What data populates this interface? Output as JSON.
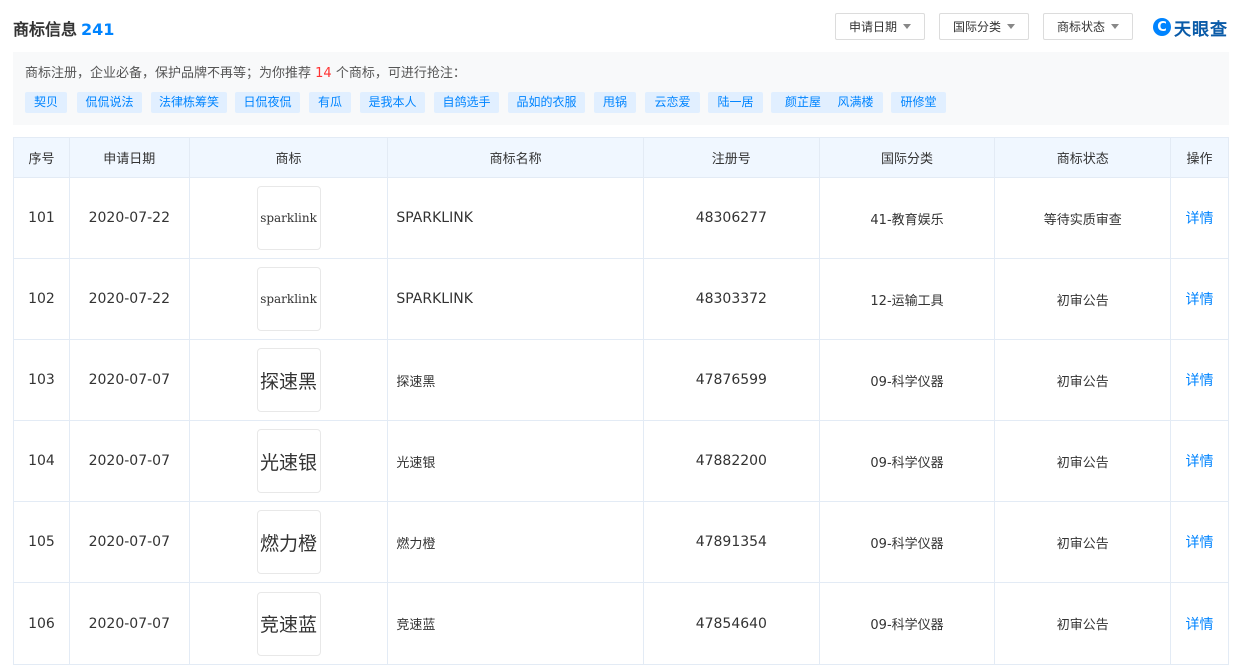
{
  "header": {
    "title": "商标信息",
    "count": "241",
    "filters": [
      "申请日期",
      "国际分类",
      "商标状态"
    ],
    "logo_text": "天眼查"
  },
  "recommend": {
    "text_before": "商标注册，企业必备，保护品牌不再等；为你推荐 ",
    "number": "14",
    "text_after": " 个商标，可进行抢注：",
    "tags": [
      "契贝",
      "侃侃说法",
      "法律栋筹笑",
      "日侃夜侃",
      "有瓜",
      "是我本人",
      "自鸽选手",
      "品如的衣服",
      "甩锅",
      "云恋爱",
      "陆一居",
      "颜芷屋",
      "风满楼",
      "研修堂"
    ]
  },
  "table": {
    "columns": [
      "序号",
      "申请日期",
      "商标",
      "商标名称",
      "注册号",
      "国际分类",
      "商标状态",
      "操作"
    ],
    "rows": [
      {
        "no": "101",
        "date": "2020-07-22",
        "mark": "sparklink",
        "name": "SPARKLINK",
        "reg": "48306277",
        "class": "41-教育娱乐",
        "status": "等待实质审查",
        "action": "详情"
      },
      {
        "no": "102",
        "date": "2020-07-22",
        "mark": "sparklink",
        "name": "SPARKLINK",
        "reg": "48303372",
        "class": "12-运输工具",
        "status": "初审公告",
        "action": "详情"
      },
      {
        "no": "103",
        "date": "2020-07-07",
        "mark": "探速黑",
        "name": "探速黑",
        "reg": "47876599",
        "class": "09-科学仪器",
        "status": "初审公告",
        "action": "详情"
      },
      {
        "no": "104",
        "date": "2020-07-07",
        "mark": "光速银",
        "name": "光速银",
        "reg": "47882200",
        "class": "09-科学仪器",
        "status": "初审公告",
        "action": "详情"
      },
      {
        "no": "105",
        "date": "2020-07-07",
        "mark": "燃力橙",
        "name": "燃力橙",
        "reg": "47891354",
        "class": "09-科学仪器",
        "status": "初审公告",
        "action": "详情"
      },
      {
        "no": "106",
        "date": "2020-07-07",
        "mark": "竞速蓝",
        "name": "竞速蓝",
        "reg": "47854640",
        "class": "09-科学仪器",
        "status": "初审公告",
        "action": "详情"
      }
    ]
  },
  "colors": {
    "accent": "#0084ff",
    "highlight": "#ff3333",
    "tag_bg": "#e1efff",
    "header_bg": "#f0f7ff"
  }
}
